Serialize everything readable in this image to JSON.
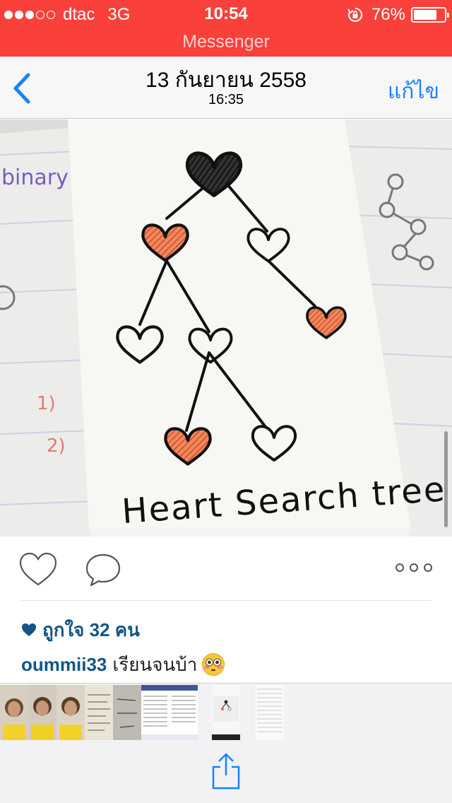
{
  "status_bar": {
    "signal_bars_filled": 3,
    "signal_bars_total": 5,
    "carrier": "dtac",
    "network": "3G",
    "time": "10:54",
    "battery_percent": "76%",
    "battery_level": 0.76,
    "icons": [
      "signal-dots-icon",
      "rotation-lock-icon",
      "battery-icon"
    ]
  },
  "banner": {
    "label": "Messenger"
  },
  "nav": {
    "back_icon": "chevron-left-icon",
    "title": "13 กันยายน 2558",
    "subtitle": "16:35",
    "edit_label": "แก้ไข"
  },
  "photo": {
    "handwritten_title": "Heart Search tree",
    "left_page_text": "binary",
    "left_page_numbers": [
      "1)",
      "2)"
    ]
  },
  "post": {
    "icons": [
      "heart-outline-icon",
      "comment-bubble-icon",
      "more-dots-icon"
    ],
    "likes_text": "ถูกใจ 32 คน",
    "username": "oummii33",
    "caption": "เรียนจนบ้า",
    "caption_emoji": "flushed-face-emoji"
  },
  "share_sheet": {
    "thumbnail_count": 10,
    "share_icon": "share-upload-icon"
  },
  "colors": {
    "status_red": "#f9403a",
    "ios_blue": "#1a82fb",
    "instagram_blue": "#125688",
    "heart_orange": "#e8623a"
  }
}
